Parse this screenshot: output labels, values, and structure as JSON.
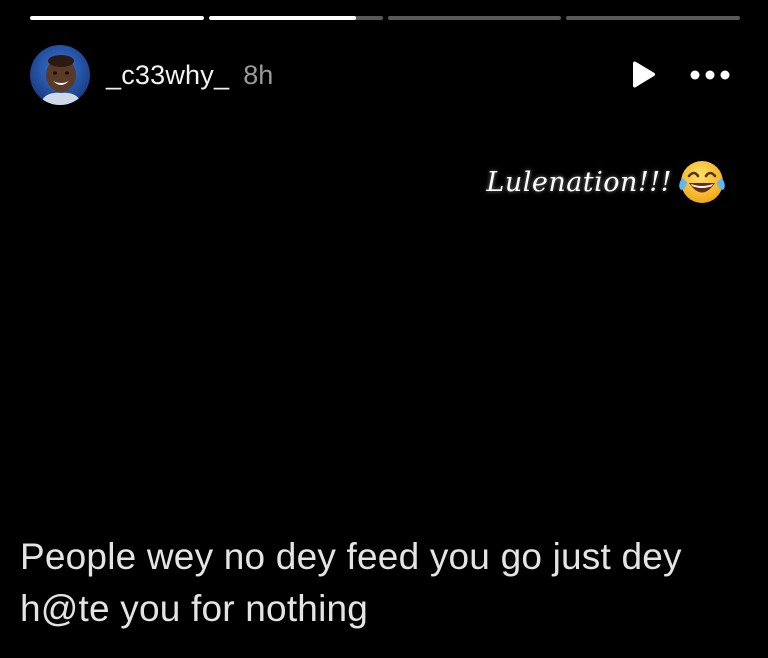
{
  "progress": {
    "segments": [
      {
        "fill": 1.0
      },
      {
        "fill": 0.85
      },
      {
        "fill": 0.0
      },
      {
        "fill": 0.0
      }
    ]
  },
  "header": {
    "username": "_c33why_",
    "timestamp": "8h",
    "play_icon": "play-icon",
    "more_icon": "more-options-icon"
  },
  "sticker": {
    "text": "Lulenation!!!",
    "emoji_icon": "face-with-tears-of-joy-icon"
  },
  "caption": {
    "text": "People wey no dey feed you go just dey h@te you for nothing"
  },
  "colors": {
    "background": "#000000",
    "progress_track": "rgba(255,255,255,0.35)",
    "progress_fill": "#ffffff",
    "username": "#f2f2f2",
    "timestamp": "#9a9a9a",
    "caption": "#e4e4e4"
  }
}
